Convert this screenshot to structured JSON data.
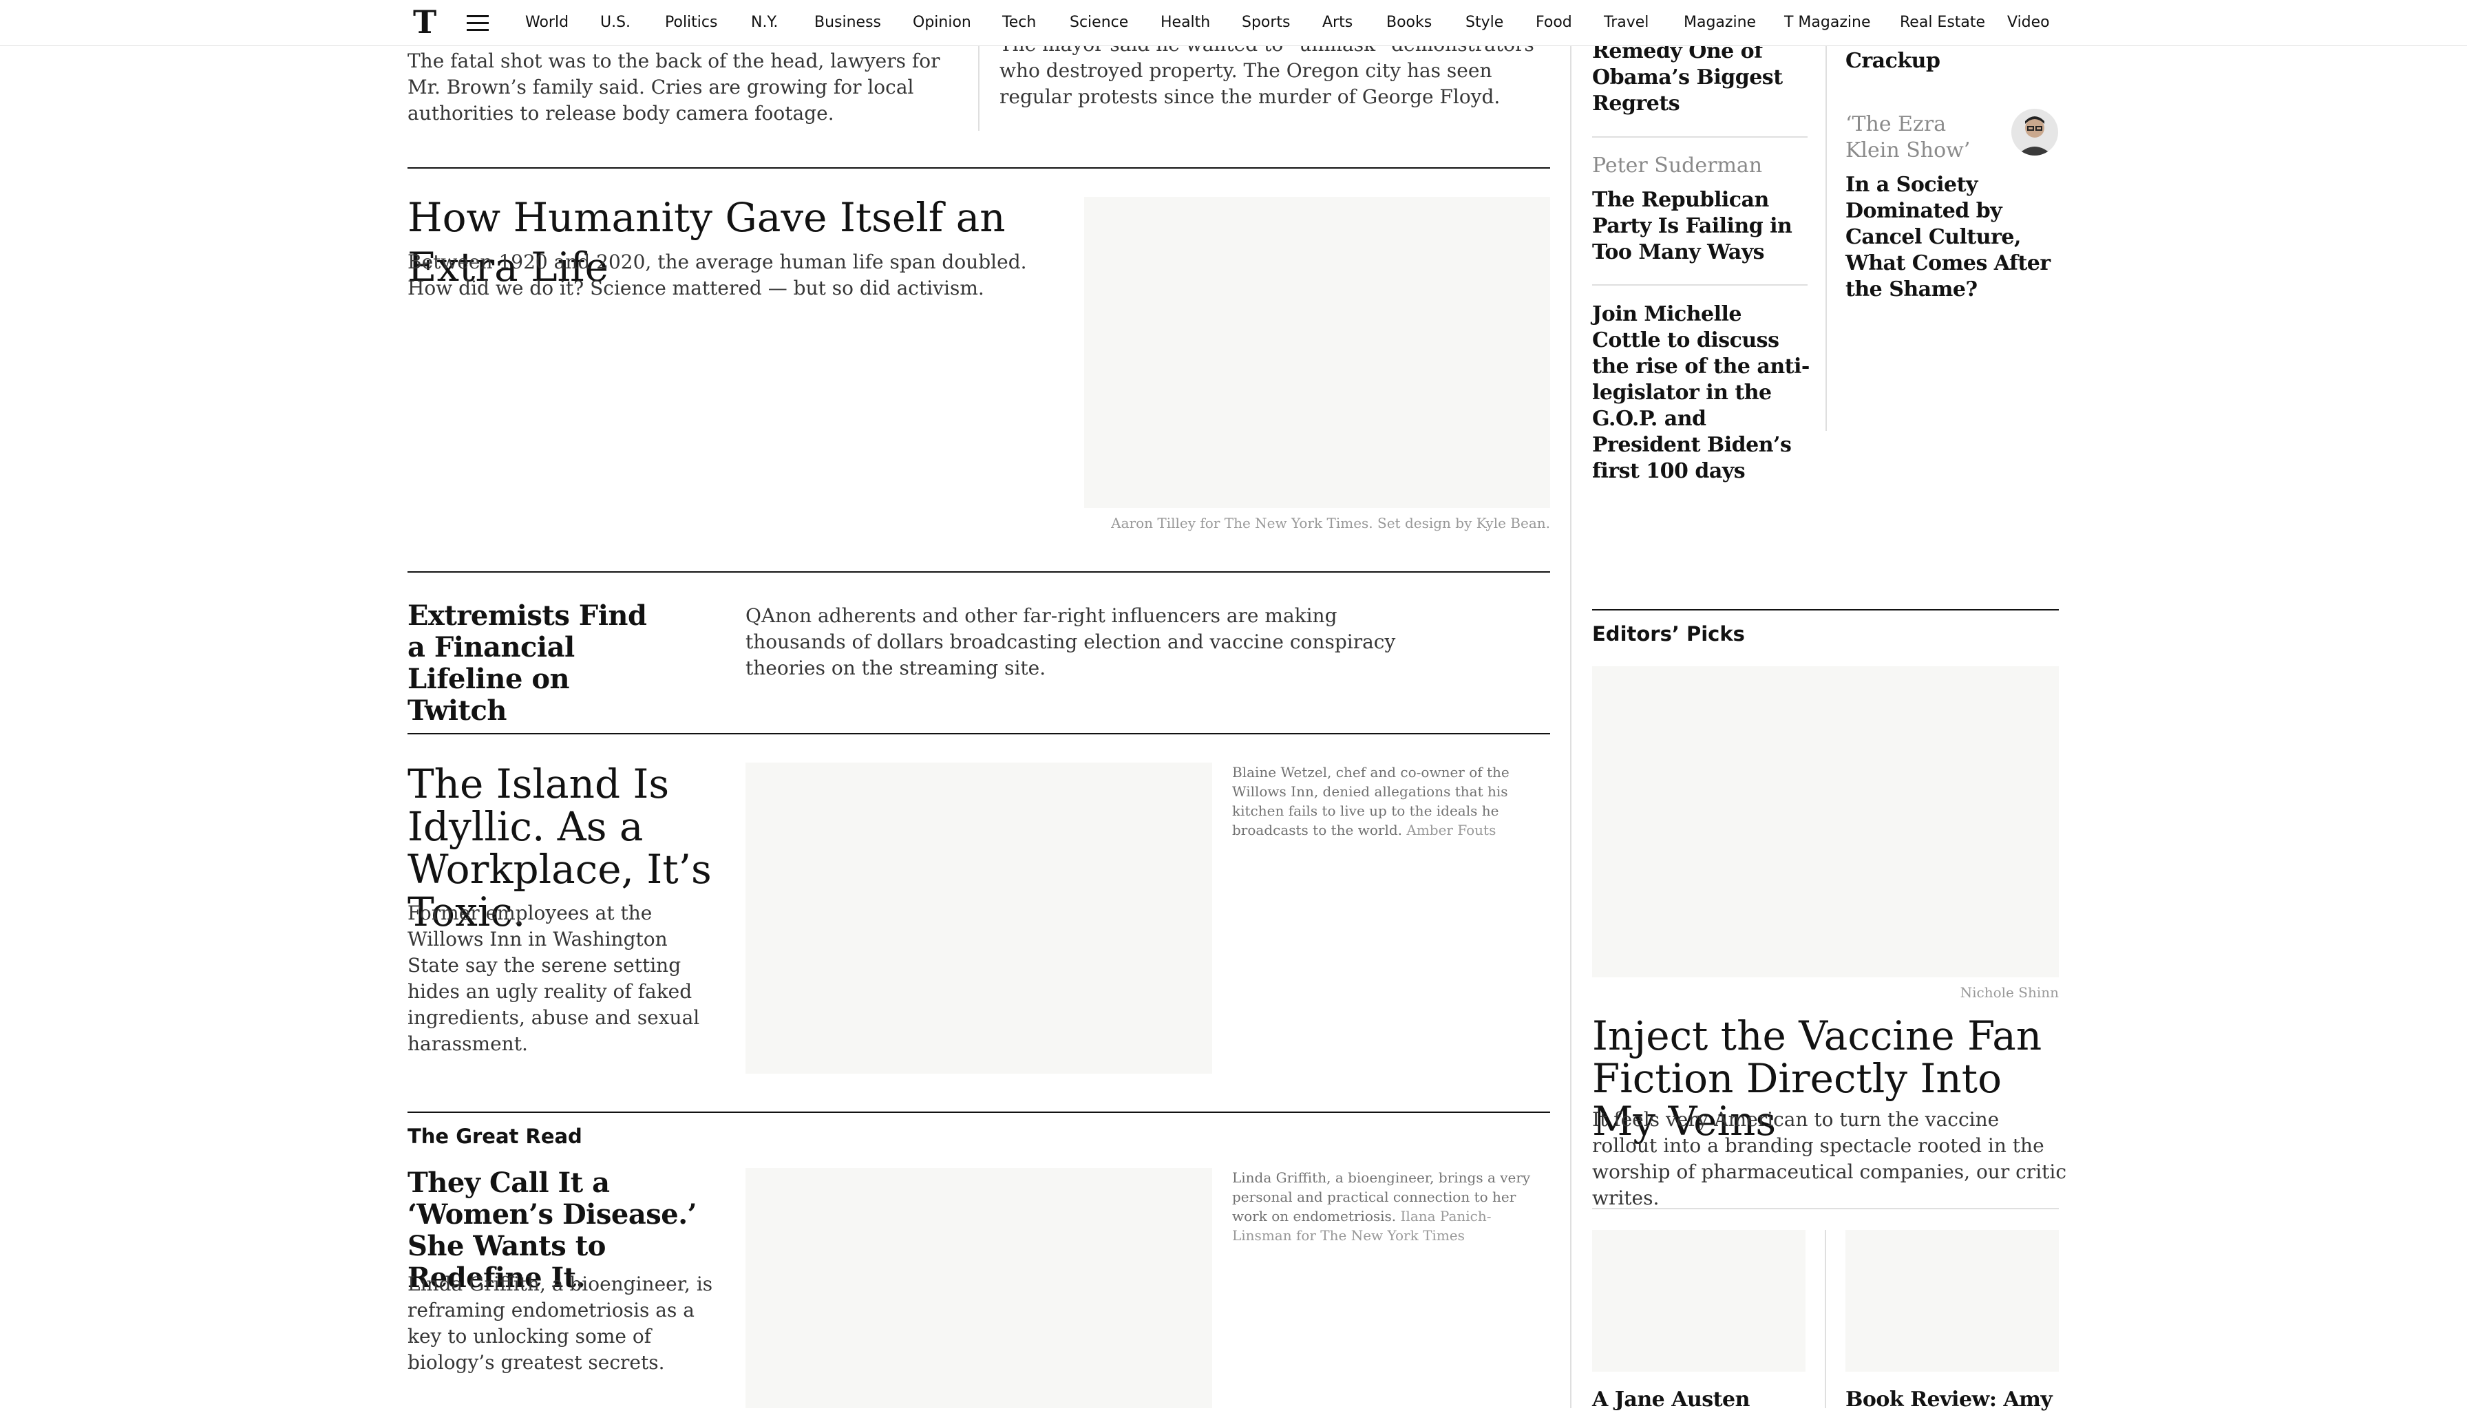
{
  "nav": {
    "logo": "T",
    "items": [
      "World",
      "U.S.",
      "Politics",
      "N.Y.",
      "Business",
      "Opinion",
      "Tech",
      "Science",
      "Health",
      "Sports",
      "Arts",
      "Books",
      "Style",
      "Food",
      "Travel",
      "Magazine",
      "T Magazine",
      "Real Estate",
      "Video"
    ]
  },
  "top_left": {
    "summary": "The fatal shot was to the back of the head, lawyers for Mr. Brown’s family said. Cries are growing for local authorities to release body camera footage."
  },
  "top_mid": {
    "summary": "The mayor said he wanted to “unmask” demonstrators who destroyed property. The Oregon city has seen regular protests since the murder of George Floyd."
  },
  "life": {
    "headline": "How Humanity Gave Itself an Extra Life",
    "summary": "Between 1920 and 2020, the average human life span doubled. How did we do it? Science mattered — but so did activism.",
    "credit": "Aaron Tilley for The New York Times. Set design by Kyle Bean."
  },
  "twitch": {
    "headline": "Extremists Find a Financial Lifeline on Twitch",
    "summary": "QAnon adherents and other far-right influencers are making thousands of dollars broadcasting election and vaccine conspiracy theories on the streaming site."
  },
  "island": {
    "headline": "The Island Is Idyllic. As a Workplace, It’s Toxic.",
    "summary": "Former employees at the Willows Inn in Washington State say the serene setting hides an ugly reality of faked ingredients, abuse and sexual harassment.",
    "caption": "Blaine Wetzel, chef and co-owner of the Willows Inn, denied allegations that his kitchen fails to live up to the ideals he broadcasts to the world.",
    "credit": "Amber Fouts"
  },
  "great_read": {
    "label": "The Great Read",
    "headline": "They Call It a ‘Women’s Disease.’ She Wants to Redefine It.",
    "summary": "Linda Griffith, a bioengineer, is reframing endometriosis as a key to unlocking some of biology’s greatest secrets.",
    "caption": "Linda Griffith, a bioengineer, brings a very personal and practical connection to her work on endometriosis.",
    "credit": "Ilana Panich-Linsman for The New York Times"
  },
  "opinion": {
    "col1": {
      "top_headline": "Remedy One of Obama’s Biggest Regrets",
      "item2_author": "Peter Suderman",
      "item2_headline": "The Republican Party Is Failing in Too Many Ways",
      "item3_headline": "Join Michelle Cottle to discuss the rise of the anti-legislator in the G.O.P. and President Biden’s first 100 days"
    },
    "col2": {
      "top_headline": "Crackup",
      "item2_author": "‘The Ezra Klein Show’",
      "item2_headline": "In a Society Dominated by Cancel Culture, What Comes After the Shame?"
    }
  },
  "editors_picks": {
    "label": "Editors’ Picks",
    "credit": "Nichole Shinn",
    "headline": "Inject the Vaccine Fan Fiction Directly Into My Veins",
    "summary": "It feels very American to turn the vaccine rollout into a branding spectacle rooted in the worship of pharmaceutical companies, our critic writes.",
    "small1_headline": "A Jane Austen",
    "small2_headline": "Book Review: Amy"
  }
}
